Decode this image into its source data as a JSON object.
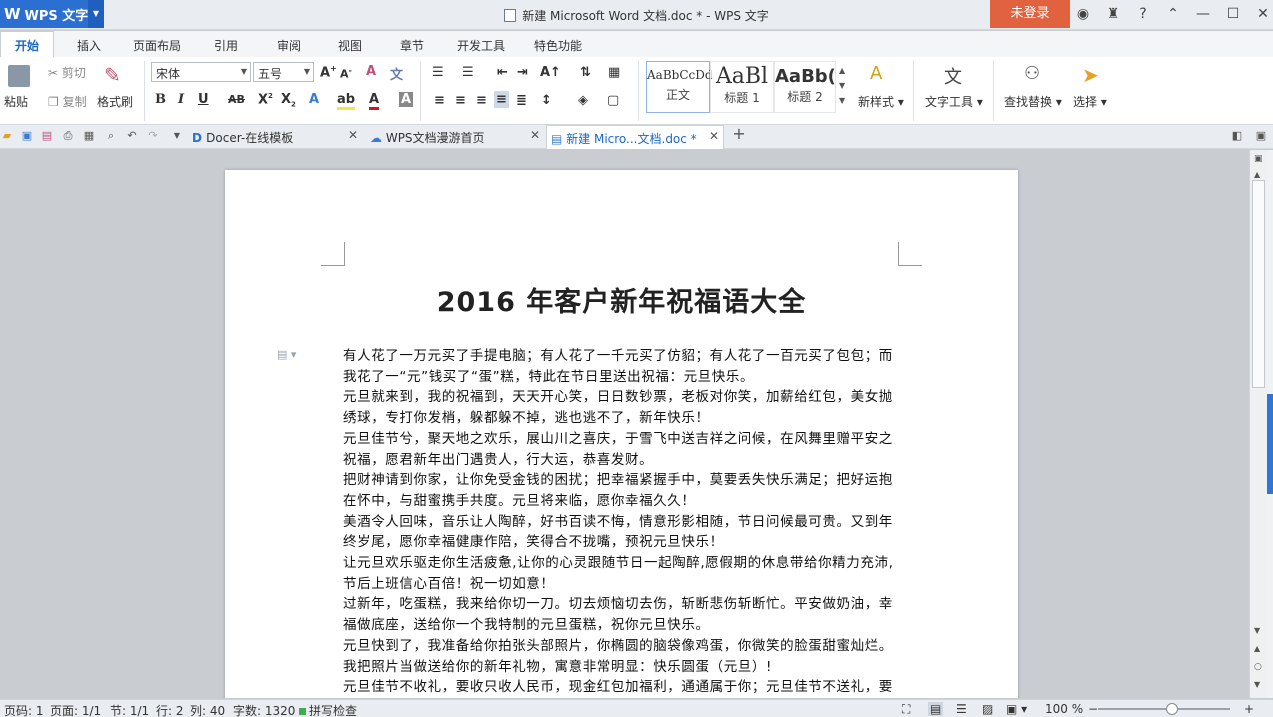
{
  "app": {
    "name": "WPS 文字",
    "title": "新建 Microsoft Word 文档.doc * - WPS 文字",
    "login": "未登录"
  },
  "menu_tabs": [
    "开始",
    "插入",
    "页面布局",
    "引用",
    "审阅",
    "视图",
    "章节",
    "开发工具",
    "特色功能"
  ],
  "ribbon": {
    "paste": "粘贴",
    "cut": "剪切",
    "copy": "复制",
    "format_painter": "格式刷",
    "font": "宋体",
    "size": "五号",
    "styles": [
      {
        "sample": "AaBbCcDd",
        "label": "正文"
      },
      {
        "sample": "AaBl",
        "label": "标题 1"
      },
      {
        "sample": "AaBb(",
        "label": "标题 2"
      }
    ],
    "new_style": "新样式",
    "text_tools": "文字工具",
    "find_replace": "查找替换",
    "select": "选择"
  },
  "doc_tabs": [
    {
      "label": "Docer-在线模板"
    },
    {
      "label": "WPS文档漫游首页"
    },
    {
      "label": "新建 Micro...文档.doc *"
    }
  ],
  "document": {
    "heading": "2016 年客户新年祝福语大全",
    "paragraphs": [
      "有人花了一万元买了手提电脑；有人花了一千元买了仿貂；有人花了一百元买了包包；而我花了一“元”钱买了“蛋”糕，特此在节日里送出祝福：元旦快乐。",
      "元旦就来到，我的祝福到，天天开心笑，日日数钞票，老板对你笑，加薪给红包，美女抛绣球，专打你发梢，躲都躲不掉，逃也逃不了，新年快乐！",
      "元旦佳节兮，聚天地之欢乐，展山川之喜庆，于雪飞中送吉祥之问候，在风舞里赠平安之祝福，愿君新年出门遇贵人，行大运，恭喜发财。",
      "把财神请到你家，让你免受金钱的困扰；把幸福紧握手中，莫要丢失快乐满足；把好运抱在怀中，与甜蜜携手共度。元旦将来临，愿你幸福久久！",
      "美酒令人回味，音乐让人陶醉，好书百读不悔，情意形影相随，节日问候最可贵。又到年终岁尾，愿你幸福健康作陪，笑得合不拢嘴，预祝元旦快乐！",
      "让元旦欢乐驱走你生活疲惫,让你的心灵跟随节日一起陶醉,愿假期的休息带给你精力充沛,节后上班信心百倍！祝一切如意！",
      "过新年，吃蛋糕，我来给你切一刀。切去烦恼切去伤，斩断悲伤斩断忙。平安做奶油，幸福做底座，送给你一个我特制的元旦蛋糕，祝你元旦快乐。",
      "元旦快到了，我准备给你拍张头部照片，你椭圆的脑袋像鸡蛋，你微笑的脸蛋甜蜜灿烂。我把照片当做送给你的新年礼物，寓意非常明显：快乐圆蛋（元旦）!",
      "元旦佳节不收礼，要收只收人民币，现金红包加福利，通通属于你；元旦佳节不送礼，要送"
    ]
  },
  "status": {
    "page_num": "页码: 1",
    "pages": "页面: 1/1",
    "section": "节: 1/1",
    "row": "行: 2",
    "col": "列: 40",
    "words": "字数: 1320",
    "spell": "拼写检查",
    "zoom": "100 %"
  },
  "colors": {
    "accent": "#2b6fd2",
    "login": "#e0623e",
    "active_tab": "#1a68c9"
  }
}
